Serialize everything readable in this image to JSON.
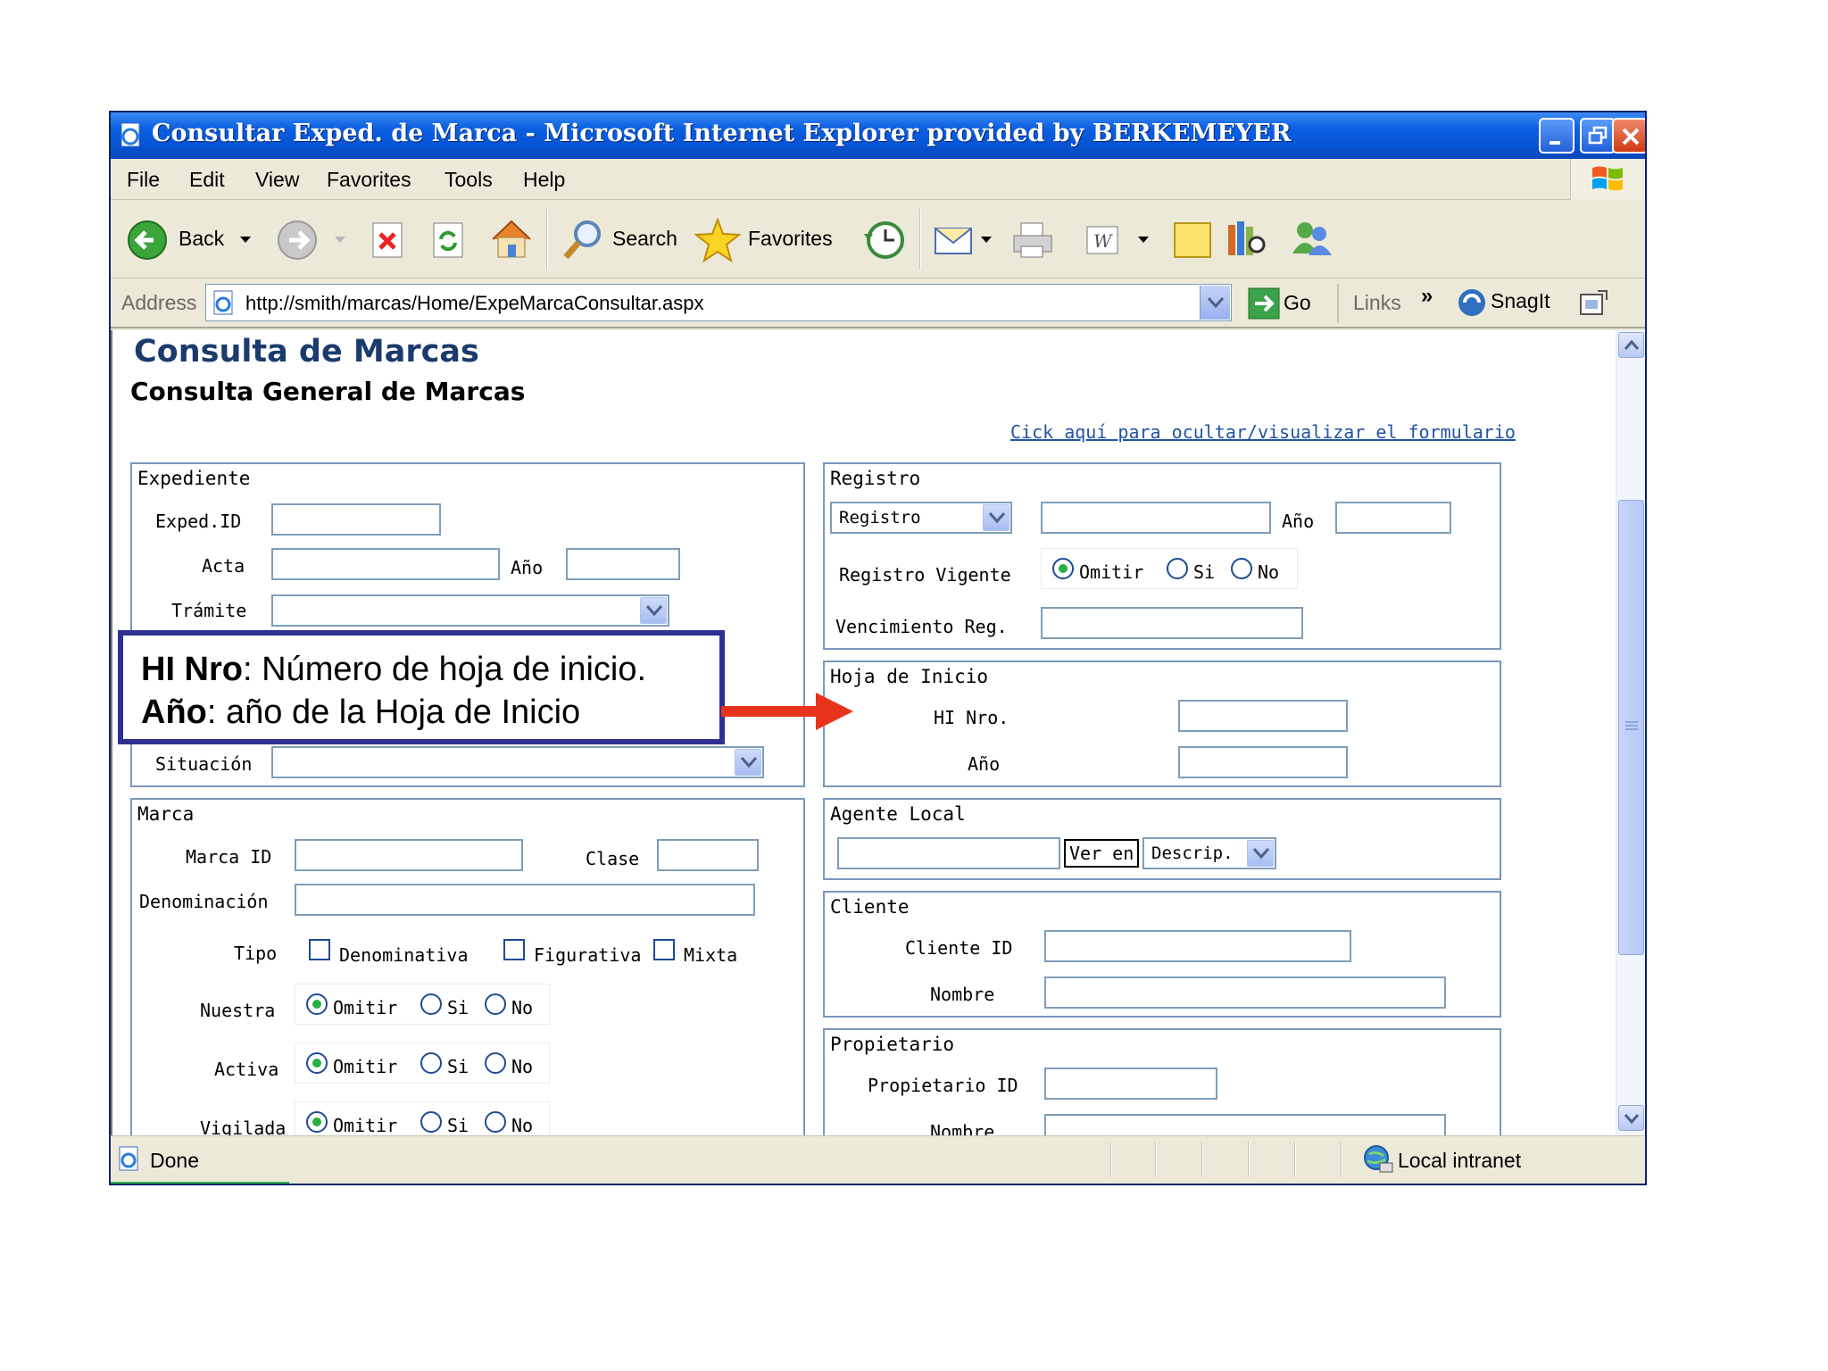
{
  "window": {
    "title": "Consultar Exped. de Marca - Microsoft Internet Explorer provided by BERKEMEYER"
  },
  "menu": [
    "File",
    "Edit",
    "View",
    "Favorites",
    "Tools",
    "Help"
  ],
  "toolbar": {
    "back": "Back",
    "search": "Search",
    "favorites": "Favorites"
  },
  "address": {
    "label": "Address",
    "url": "http://smith/marcas/Home/ExpeMarcaConsultar.aspx",
    "go": "Go",
    "links": "Links",
    "links_more": "»",
    "snagit": "SnagIt"
  },
  "page": {
    "title": "Consulta de Marcas",
    "subtitle": "Consulta General de Marcas",
    "toggle_link": "Cick aquí para ocultar/visualizar el formulario"
  },
  "expediente": {
    "legend": "Expediente",
    "exped_id": "Exped.ID",
    "acta": "Acta",
    "anio": "Año",
    "tramite": "Trámite",
    "situacion": "Situación"
  },
  "marca": {
    "legend": "Marca",
    "marca_id": "Marca ID",
    "clase": "Clase",
    "denominacion": "Denominación",
    "tipo": "Tipo",
    "tipo_opts": [
      "Denominativa",
      "Figurativa",
      "Mixta"
    ],
    "nuestra": "Nuestra",
    "activa": "Activa",
    "vigilada": "Vigilada",
    "radio_opts": [
      "Omitir",
      "Si",
      "No"
    ]
  },
  "registro": {
    "legend": "Registro",
    "select_value": "Registro",
    "anio": "Año",
    "vigente": "Registro Vigente",
    "vigente_opts": [
      "Omitir",
      "Si",
      "No"
    ],
    "vencimiento": "Vencimiento Reg."
  },
  "hoja": {
    "legend": "Hoja de Inicio",
    "hi_nro": "HI Nro.",
    "anio": "Año"
  },
  "agente": {
    "legend": "Agente Local",
    "ver_en": "Ver en",
    "descrip": "Descrip."
  },
  "cliente": {
    "legend": "Cliente",
    "cliente_id": "Cliente ID",
    "nombre": "Nombre"
  },
  "propietario": {
    "legend": "Propietario",
    "propietario_id": "Propietario ID",
    "nombre": "Nombre"
  },
  "status": {
    "done": "Done",
    "zone": "Local intranet"
  },
  "callout": {
    "line1_bold": "HI Nro",
    "line1_rest": ": Número de hoja de inicio.",
    "line2_bold": "Año",
    "line2_rest": ": año de la Hoja de Inicio"
  },
  "colors": {
    "title_bar": "#0653d6",
    "heading": "#1b3b6e",
    "link": "#2154a4",
    "panel_border": "#7a96bd",
    "callout_border": "#2e3192",
    "arrow": "#e8341c"
  }
}
